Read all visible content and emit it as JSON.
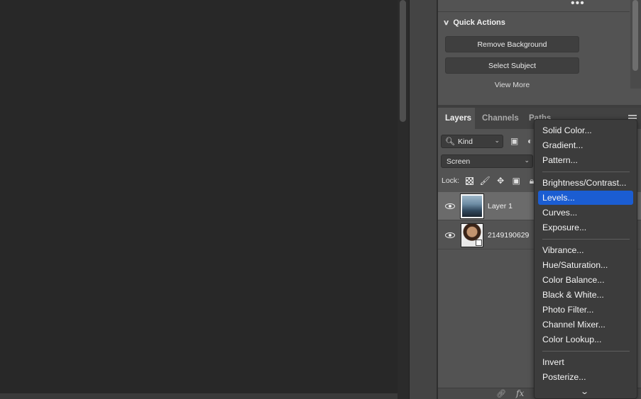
{
  "quick_actions": {
    "title": "Quick Actions",
    "buttons": [
      "Remove Background",
      "Select Subject"
    ],
    "view_more": "View More"
  },
  "layers_panel": {
    "tabs": [
      "Layers",
      "Channels",
      "Paths"
    ],
    "filter_kind": "Kind",
    "blend_mode": "Screen",
    "lock_label": "Lock:",
    "layers": [
      {
        "name": "Layer 1",
        "selected": true,
        "visible": true
      },
      {
        "name": "2149190629",
        "selected": false,
        "visible": true,
        "smart_object": true
      }
    ]
  },
  "adjustment_menu": {
    "groups": [
      [
        "Solid Color...",
        "Gradient...",
        "Pattern..."
      ],
      [
        "Brightness/Contrast...",
        "Levels...",
        "Curves...",
        "Exposure..."
      ],
      [
        "Vibrance...",
        "Hue/Saturation...",
        "Color Balance...",
        "Black & White...",
        "Photo Filter...",
        "Channel Mixer...",
        "Color Lookup..."
      ],
      [
        "Invert",
        "Posterize..."
      ]
    ],
    "highlighted": "Levels..."
  },
  "colors": {
    "highlight": "#1b5dd2",
    "panel_bg": "#535353",
    "canvas_bg": "#282828"
  }
}
